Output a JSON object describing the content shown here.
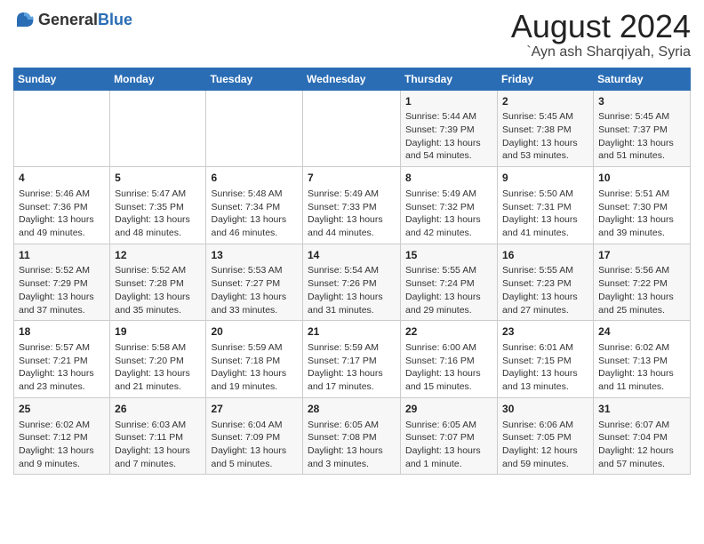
{
  "logo": {
    "general": "General",
    "blue": "Blue"
  },
  "title": "August 2024",
  "subtitle": "`Ayn ash Sharqiyah, Syria",
  "weekdays": [
    "Sunday",
    "Monday",
    "Tuesday",
    "Wednesday",
    "Thursday",
    "Friday",
    "Saturday"
  ],
  "weeks": [
    [
      {
        "day": "",
        "info": ""
      },
      {
        "day": "",
        "info": ""
      },
      {
        "day": "",
        "info": ""
      },
      {
        "day": "",
        "info": ""
      },
      {
        "day": "1",
        "info": "Sunrise: 5:44 AM\nSunset: 7:39 PM\nDaylight: 13 hours\nand 54 minutes."
      },
      {
        "day": "2",
        "info": "Sunrise: 5:45 AM\nSunset: 7:38 PM\nDaylight: 13 hours\nand 53 minutes."
      },
      {
        "day": "3",
        "info": "Sunrise: 5:45 AM\nSunset: 7:37 PM\nDaylight: 13 hours\nand 51 minutes."
      }
    ],
    [
      {
        "day": "4",
        "info": "Sunrise: 5:46 AM\nSunset: 7:36 PM\nDaylight: 13 hours\nand 49 minutes."
      },
      {
        "day": "5",
        "info": "Sunrise: 5:47 AM\nSunset: 7:35 PM\nDaylight: 13 hours\nand 48 minutes."
      },
      {
        "day": "6",
        "info": "Sunrise: 5:48 AM\nSunset: 7:34 PM\nDaylight: 13 hours\nand 46 minutes."
      },
      {
        "day": "7",
        "info": "Sunrise: 5:49 AM\nSunset: 7:33 PM\nDaylight: 13 hours\nand 44 minutes."
      },
      {
        "day": "8",
        "info": "Sunrise: 5:49 AM\nSunset: 7:32 PM\nDaylight: 13 hours\nand 42 minutes."
      },
      {
        "day": "9",
        "info": "Sunrise: 5:50 AM\nSunset: 7:31 PM\nDaylight: 13 hours\nand 41 minutes."
      },
      {
        "day": "10",
        "info": "Sunrise: 5:51 AM\nSunset: 7:30 PM\nDaylight: 13 hours\nand 39 minutes."
      }
    ],
    [
      {
        "day": "11",
        "info": "Sunrise: 5:52 AM\nSunset: 7:29 PM\nDaylight: 13 hours\nand 37 minutes."
      },
      {
        "day": "12",
        "info": "Sunrise: 5:52 AM\nSunset: 7:28 PM\nDaylight: 13 hours\nand 35 minutes."
      },
      {
        "day": "13",
        "info": "Sunrise: 5:53 AM\nSunset: 7:27 PM\nDaylight: 13 hours\nand 33 minutes."
      },
      {
        "day": "14",
        "info": "Sunrise: 5:54 AM\nSunset: 7:26 PM\nDaylight: 13 hours\nand 31 minutes."
      },
      {
        "day": "15",
        "info": "Sunrise: 5:55 AM\nSunset: 7:24 PM\nDaylight: 13 hours\nand 29 minutes."
      },
      {
        "day": "16",
        "info": "Sunrise: 5:55 AM\nSunset: 7:23 PM\nDaylight: 13 hours\nand 27 minutes."
      },
      {
        "day": "17",
        "info": "Sunrise: 5:56 AM\nSunset: 7:22 PM\nDaylight: 13 hours\nand 25 minutes."
      }
    ],
    [
      {
        "day": "18",
        "info": "Sunrise: 5:57 AM\nSunset: 7:21 PM\nDaylight: 13 hours\nand 23 minutes."
      },
      {
        "day": "19",
        "info": "Sunrise: 5:58 AM\nSunset: 7:20 PM\nDaylight: 13 hours\nand 21 minutes."
      },
      {
        "day": "20",
        "info": "Sunrise: 5:59 AM\nSunset: 7:18 PM\nDaylight: 13 hours\nand 19 minutes."
      },
      {
        "day": "21",
        "info": "Sunrise: 5:59 AM\nSunset: 7:17 PM\nDaylight: 13 hours\nand 17 minutes."
      },
      {
        "day": "22",
        "info": "Sunrise: 6:00 AM\nSunset: 7:16 PM\nDaylight: 13 hours\nand 15 minutes."
      },
      {
        "day": "23",
        "info": "Sunrise: 6:01 AM\nSunset: 7:15 PM\nDaylight: 13 hours\nand 13 minutes."
      },
      {
        "day": "24",
        "info": "Sunrise: 6:02 AM\nSunset: 7:13 PM\nDaylight: 13 hours\nand 11 minutes."
      }
    ],
    [
      {
        "day": "25",
        "info": "Sunrise: 6:02 AM\nSunset: 7:12 PM\nDaylight: 13 hours\nand 9 minutes."
      },
      {
        "day": "26",
        "info": "Sunrise: 6:03 AM\nSunset: 7:11 PM\nDaylight: 13 hours\nand 7 minutes."
      },
      {
        "day": "27",
        "info": "Sunrise: 6:04 AM\nSunset: 7:09 PM\nDaylight: 13 hours\nand 5 minutes."
      },
      {
        "day": "28",
        "info": "Sunrise: 6:05 AM\nSunset: 7:08 PM\nDaylight: 13 hours\nand 3 minutes."
      },
      {
        "day": "29",
        "info": "Sunrise: 6:05 AM\nSunset: 7:07 PM\nDaylight: 13 hours\nand 1 minute."
      },
      {
        "day": "30",
        "info": "Sunrise: 6:06 AM\nSunset: 7:05 PM\nDaylight: 12 hours\nand 59 minutes."
      },
      {
        "day": "31",
        "info": "Sunrise: 6:07 AM\nSunset: 7:04 PM\nDaylight: 12 hours\nand 57 minutes."
      }
    ]
  ]
}
